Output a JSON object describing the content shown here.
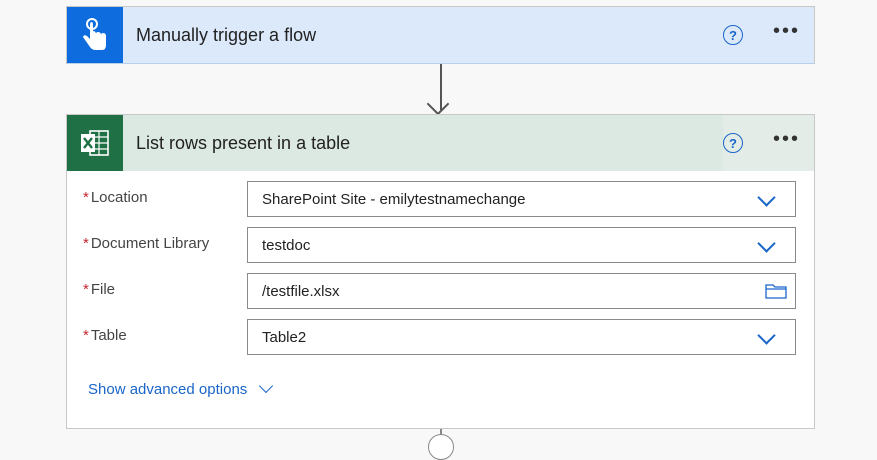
{
  "trigger": {
    "title": "Manually trigger a flow",
    "icon": "touch-hand-icon",
    "help_label": "?",
    "more_label": "•••"
  },
  "action": {
    "title": "List rows present in a table",
    "icon": "excel-icon",
    "help_label": "?",
    "more_label": "•••",
    "fields": [
      {
        "label": "Location",
        "value": "SharePoint Site - emilytestnamechange",
        "control": "dropdown"
      },
      {
        "label": "Document Library",
        "value": "testdoc",
        "control": "dropdown"
      },
      {
        "label": "File",
        "value": "/testfile.xlsx",
        "control": "file-picker"
      },
      {
        "label": "Table",
        "value": "Table2",
        "control": "dropdown"
      }
    ],
    "required_marker": "*",
    "advanced_link": "Show advanced options"
  },
  "colors": {
    "trigger_accent": "#0f6cde",
    "excel_accent": "#1f7145",
    "link": "#1a66c9",
    "required": "#c4262e"
  }
}
